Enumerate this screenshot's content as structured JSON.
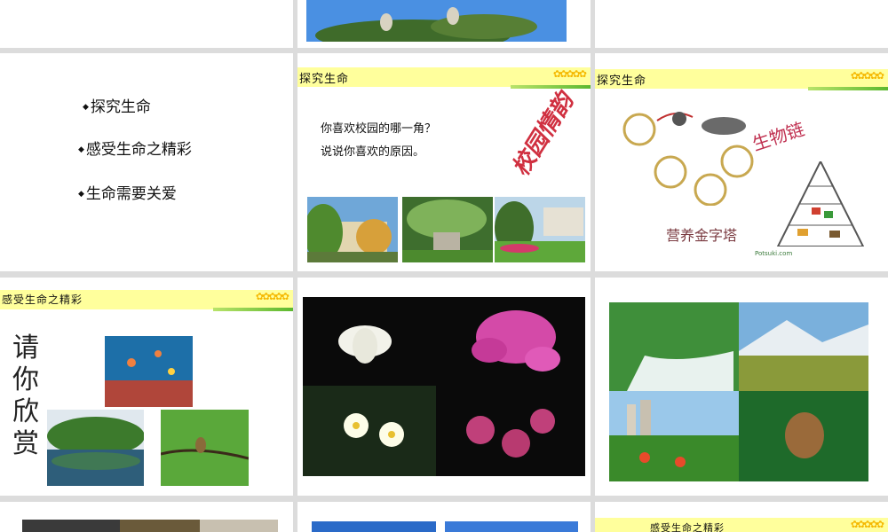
{
  "slides": {
    "outline": {
      "items": [
        "探究生命",
        "感受生命之精彩",
        "生命需要关爱"
      ]
    },
    "campus": {
      "header": "探究生命",
      "question1": "你喜欢校园的哪一角？",
      "question2": "说说你喜欢的原因。",
      "art_text": "校园情韵"
    },
    "foodchain": {
      "header": "探究生命",
      "chain_label": "生物链",
      "pyramid_label": "营养金字塔",
      "watermark": "Potsuki.com"
    },
    "appreciate": {
      "header": "感受生命之精彩",
      "vertical_title": [
        "请",
        "你",
        "欣",
        "赏"
      ]
    },
    "bottom_right": {
      "header": "感受生命之精彩"
    }
  },
  "colors": {
    "header_bg": "#ffff9c",
    "canvas_bg": "#dcdcdc"
  }
}
